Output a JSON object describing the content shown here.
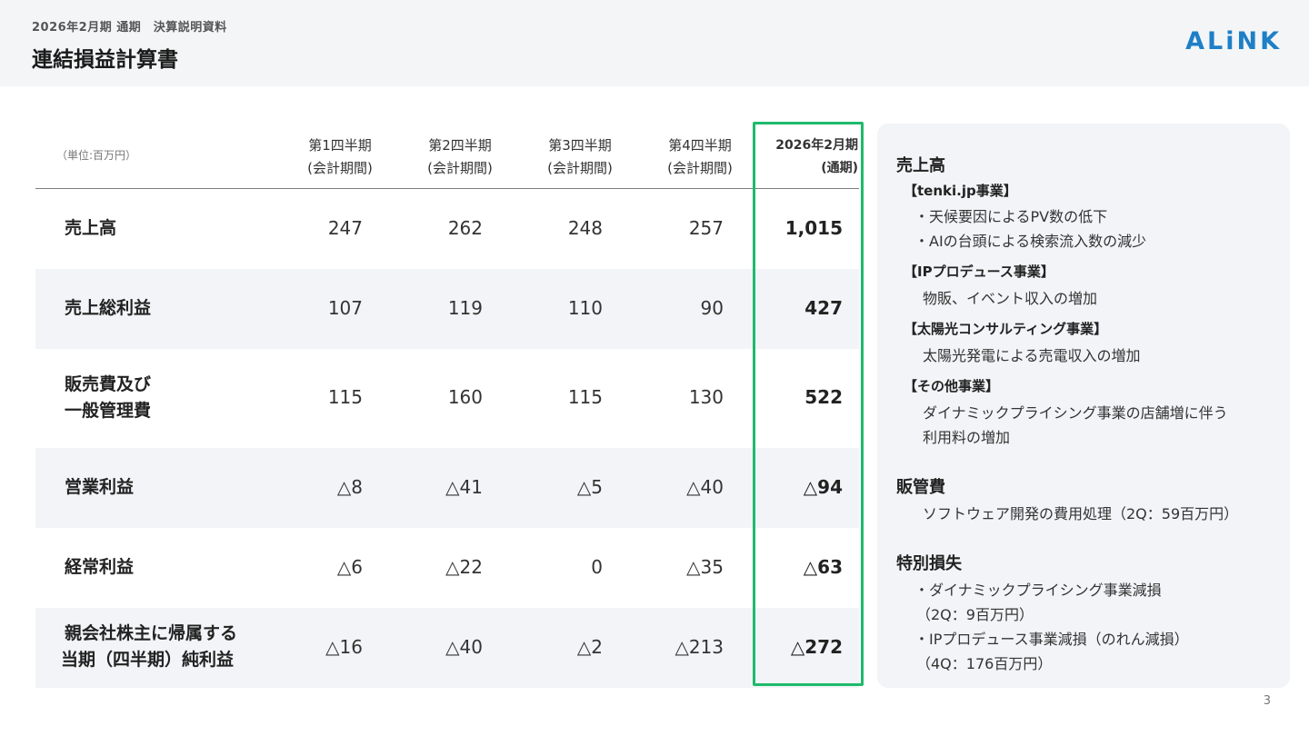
{
  "header": {
    "subtitle": "2026年2月期 通期　決算説明資料",
    "title": "連結損益計算書",
    "logo": "ALiNK"
  },
  "table": {
    "unit": "（単位:百万円）",
    "columns": [
      {
        "line1": "第1四半期",
        "line2": "(会計期間)"
      },
      {
        "line1": "第2四半期",
        "line2": "(会計期間)"
      },
      {
        "line1": "第3四半期",
        "line2": "(会計期間)"
      },
      {
        "line1": "第4四半期",
        "line2": "(会計期間)"
      },
      {
        "line1": "2026年2月期",
        "line2": "(通期)"
      }
    ],
    "rows": [
      {
        "label1": "売上高",
        "label2": "",
        "values": [
          "247",
          "262",
          "248",
          "257",
          "1,015"
        ]
      },
      {
        "label1": "売上総利益",
        "label2": "",
        "values": [
          "107",
          "119",
          "110",
          "90",
          "427"
        ]
      },
      {
        "label1": "販売費及び",
        "label2": "一般管理費",
        "values": [
          "115",
          "160",
          "115",
          "130",
          "522"
        ]
      },
      {
        "label1": "営業利益",
        "label2": "",
        "values": [
          "△8",
          "△41",
          "△5",
          "△40",
          "△94"
        ]
      },
      {
        "label1": "経常利益",
        "label2": "",
        "values": [
          "△6",
          "△22",
          "0",
          "△35",
          "△63"
        ]
      },
      {
        "label1": "親会社株主に帰属する",
        "label2": "当期（四半期）純利益",
        "values": [
          "△16",
          "△40",
          "△2",
          "△213",
          "△272"
        ]
      }
    ]
  },
  "notes": {
    "sales_heading": "売上高",
    "tenki_heading": "【tenki.jp事業】",
    "tenki_items": [
      "・天候要因によるPV数の低下",
      "・AIの台頭による検索流入数の減少"
    ],
    "ip_heading": "【IPプロデュース事業】",
    "ip_item": "物販、イベント収入の増加",
    "solar_heading": "【太陽光コンサルティング事業】",
    "solar_item": "太陽光発電による売電収入の増加",
    "other_heading": "【その他事業】",
    "other_item_1": "ダイナミックプライシング事業の店舗増に伴う",
    "other_item_2": "利用料の増加",
    "sga_heading": "販管費",
    "sga_item": "ソフトウェア開発の費用処理（2Q：59百万円）",
    "special_heading": "特別損失",
    "special_item_1": "・ダイナミックプライシング事業減損",
    "special_item_1b": "（2Q：9百万円）",
    "special_item_2": "・IPプロデュース事業減損（のれん減損）",
    "special_item_2b": "（4Q：176百万円）"
  },
  "page_number": "3",
  "colors": {
    "accent_blue": "#1e7fc7",
    "highlight_green": "#1fba6b",
    "row_shade": "#f2f4f7"
  }
}
